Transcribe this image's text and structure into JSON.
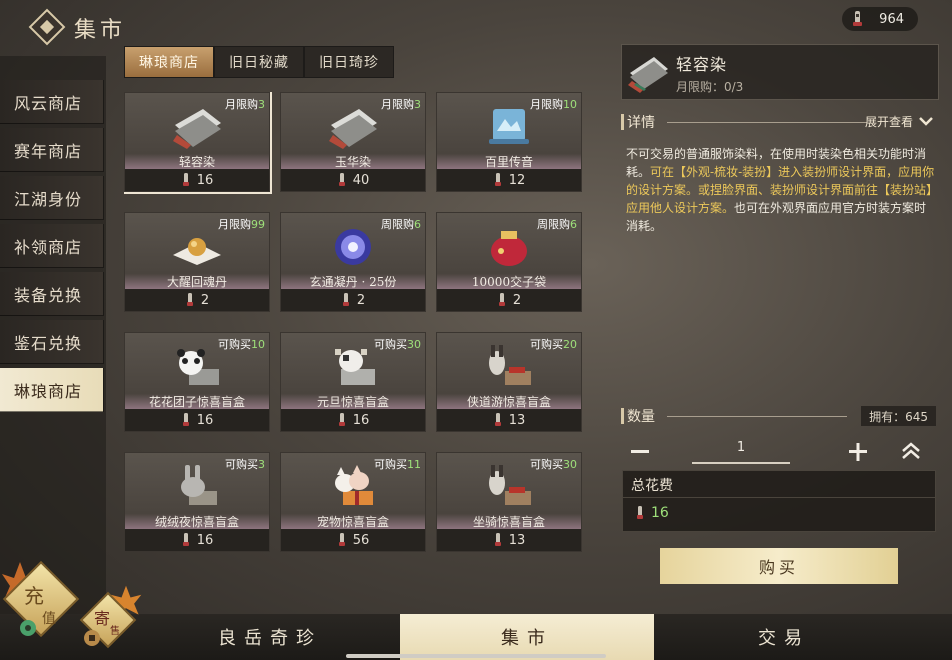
{
  "header": {
    "title": "集市",
    "currency_amount": "964"
  },
  "sidebar": {
    "items": [
      {
        "label": "风云商店"
      },
      {
        "label": "赛年商店"
      },
      {
        "label": "江湖身份"
      },
      {
        "label": "补领商店"
      },
      {
        "label": "装备兑换"
      },
      {
        "label": "鉴石兑换"
      },
      {
        "label": "琳琅商店"
      }
    ],
    "active_index": 6
  },
  "tabs": [
    {
      "label": "琳琅商店"
    },
    {
      "label": "旧日秘藏"
    },
    {
      "label": "旧日琦珍"
    }
  ],
  "items": [
    {
      "name": "轻容染",
      "limit_label": "月限购",
      "limit_num": "3",
      "price": "16",
      "icon": "dye-fabric-icon"
    },
    {
      "name": "玉华染",
      "limit_label": "月限购",
      "limit_num": "3",
      "price": "40",
      "icon": "dye-fabric-icon"
    },
    {
      "name": "百里传音",
      "limit_label": "月限购",
      "limit_num": "10",
      "price": "12",
      "icon": "scroll-icon"
    },
    {
      "name": "大醒回魂丹",
      "limit_label": "月限购",
      "limit_num": "99",
      "price": "2",
      "icon": "pill-icon"
    },
    {
      "name": "玄通凝丹 · 25份",
      "limit_label": "周限购",
      "limit_num": "6",
      "price": "2",
      "icon": "orb-icon"
    },
    {
      "name": "10000交子袋",
      "limit_label": "周限购",
      "limit_num": "6",
      "price": "2",
      "icon": "pouch-icon"
    },
    {
      "name": "花花团子惊喜盲盒",
      "limit_label": "可购买",
      "limit_num": "10",
      "price": "16",
      "icon": "panda-box-icon"
    },
    {
      "name": "元旦惊喜盲盒",
      "limit_label": "可购买",
      "limit_num": "30",
      "price": "16",
      "icon": "cow-box-icon"
    },
    {
      "name": "侠道游惊喜盲盒",
      "limit_label": "可购买",
      "limit_num": "20",
      "price": "13",
      "icon": "donkey-box-icon"
    },
    {
      "name": "绒绒夜惊喜盲盒",
      "limit_label": "可购买",
      "limit_num": "3",
      "price": "16",
      "icon": "rabbit-box-icon"
    },
    {
      "name": "宠物惊喜盲盒",
      "limit_label": "可购买",
      "limit_num": "11",
      "price": "56",
      "icon": "cat-box-icon"
    },
    {
      "name": "坐骑惊喜盲盒",
      "limit_label": "可购买",
      "limit_num": "30",
      "price": "13",
      "icon": "donkey-box-icon"
    }
  ],
  "detail": {
    "name": "轻容染",
    "limit": "月限购：0/3",
    "section_label": "详情",
    "expand_label": "展开查看",
    "desc_parts": [
      {
        "text": "不可交易的普通服饰染料，在使用时装染色相关功能时消耗。",
        "hl": false
      },
      {
        "text": "可在【外观-梳妆-装扮】进入装扮师设计界面，应用你的设计方案。或捏脸界面、装扮师设计界面前往【装扮站】应用他人设计方案。",
        "hl": true
      },
      {
        "text": "也可在外观界面应用官方时装方案时消耗。",
        "hl": false
      }
    ]
  },
  "quantity": {
    "label": "数量",
    "owned": "拥有：645",
    "value": "1"
  },
  "cost": {
    "label": "总花费",
    "value": "16"
  },
  "buy_label": "购买",
  "bottom_tabs": [
    {
      "label": "良岳奇珍"
    },
    {
      "label": "集市"
    },
    {
      "label": "交易"
    }
  ],
  "badges": {
    "recharge_1": "充",
    "recharge_2": "值",
    "consign_1": "寄",
    "consign_2": "售"
  },
  "colors": {
    "accent_green": "#9ee07a",
    "highlight_yellow": "#ecc85a",
    "active_cream": "#f1e9d2"
  }
}
